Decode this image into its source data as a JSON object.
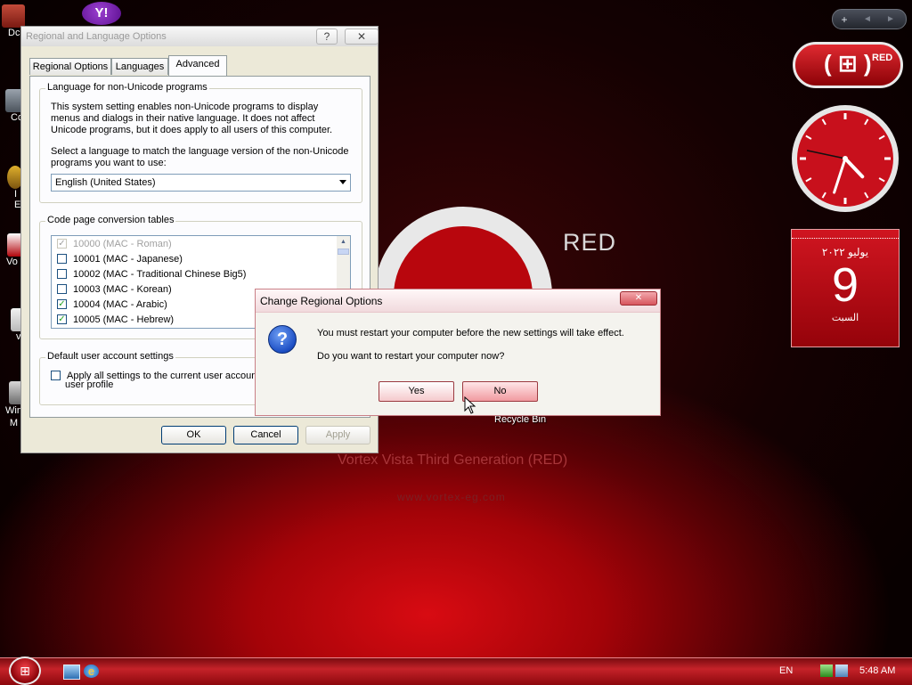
{
  "desktop": {
    "icons": [
      {
        "label": "Dc"
      },
      {
        "label": "Co"
      },
      {
        "label": "I\nE"
      },
      {
        "label": "Vo"
      },
      {
        "label": "v"
      },
      {
        "label": "Win\nM"
      }
    ],
    "recycle_bin": "Recycle Bin",
    "wallpaper_brand": "RED",
    "wallpaper_caption": "Vortex Vista Third Generation (RED)",
    "wallpaper_url": "www.vortex-eg.com"
  },
  "gadgets": {
    "controls": {
      "add": "+",
      "prev": "◄",
      "next": "►"
    },
    "badge_text": "RED",
    "clock": {
      "hour": 4,
      "minute": 33,
      "second": 47
    },
    "calendar": {
      "month_year": "يوليو ٢٠٢٢",
      "day": "9",
      "weekday": "السبت"
    }
  },
  "dialog": {
    "title": "Regional and Language Options",
    "help_label": "?",
    "close_label": "✕",
    "tabs": [
      {
        "label": "Regional Options"
      },
      {
        "label": "Languages"
      },
      {
        "label": "Advanced"
      }
    ],
    "nonunicode": {
      "caption": "Language for non-Unicode programs",
      "description": "This system setting enables non-Unicode programs to display menus and dialogs in their native language. It does not affect Unicode programs, but it does apply to all users of this computer.",
      "prompt": "Select a language to match the language version of the non-Unicode programs you want to use:",
      "selected_language": "English (United States)"
    },
    "codepages": {
      "caption": "Code page conversion tables",
      "items": [
        {
          "label": "10000 (MAC - Roman)",
          "checked": true,
          "disabled": true
        },
        {
          "label": "10001 (MAC - Japanese)",
          "checked": false,
          "disabled": false
        },
        {
          "label": "10002 (MAC - Traditional Chinese Big5)",
          "checked": false,
          "disabled": false
        },
        {
          "label": "10003 (MAC - Korean)",
          "checked": false,
          "disabled": false
        },
        {
          "label": "10004 (MAC - Arabic)",
          "checked": true,
          "disabled": false
        },
        {
          "label": "10005 (MAC - Hebrew)",
          "checked": true,
          "disabled": false
        }
      ]
    },
    "default_user": {
      "caption": "Default user account settings",
      "checkbox_label": "Apply all settings to the current user account",
      "checkbox_label_2": "user profile"
    },
    "buttons": {
      "ok": "OK",
      "cancel": "Cancel",
      "apply": "Apply"
    }
  },
  "message_box": {
    "title": "Change Regional Options",
    "close_label": "✕",
    "icon": "question-icon",
    "line1": "You must restart your computer before the new settings will take effect.",
    "line2": "Do you want to restart your computer now?",
    "yes_label": "Yes",
    "no_label": "No"
  },
  "taskbar": {
    "language": "EN",
    "time": "5:48 AM"
  },
  "colors": {
    "accent": "#c52229",
    "desktop_dark": "#140102",
    "dialog_bg": "#ece9d8"
  }
}
